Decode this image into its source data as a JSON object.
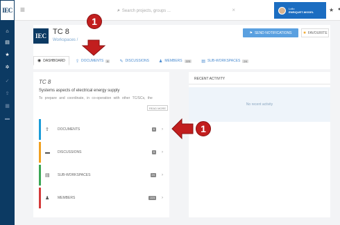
{
  "sidebar": {
    "logo_text": "IEC",
    "icons": [
      "home-icon",
      "list-icon",
      "star-icon",
      "gear-icon",
      "check-icon",
      "upload-icon",
      "calendar-icon",
      "chat-icon"
    ]
  },
  "topbar": {
    "menu_glyph": "≡",
    "search_icon": "⌕",
    "search_placeholder": "Search projects, groups ...",
    "clear_glyph": "×",
    "user": {
      "line1": "Lollo",
      "line2": "ENRIQUET-MODEL"
    },
    "star_glyph": "★",
    "bell_glyph": "●"
  },
  "header": {
    "logo_text": "IEC",
    "title": "TC 8",
    "breadcrumb": "Workspaces  /",
    "notify_label": "SEND NOTIFICATIONS",
    "notify_icon": "⚑",
    "favourite_label": "FAVOURITE",
    "favourite_icon": "★"
  },
  "tabs": [
    {
      "label": "DASHBOARD",
      "icon": "◉",
      "badge": ""
    },
    {
      "label": "DOCUMENTS",
      "icon": "⇪",
      "badge": "6"
    },
    {
      "label": "DISCUSSIONS",
      "icon": "✎",
      "badge": ""
    },
    {
      "label": "MEMBERS",
      "icon": "♟",
      "badge": "223"
    },
    {
      "label": "SUB-WORKSPACES",
      "icon": "▤",
      "badge": "24"
    }
  ],
  "overview": {
    "title": "TC 8",
    "subtitle": "Systems aspects of electrical energy supply",
    "description": "To prepare and coordinate, in co-operation with other TC/SCs, the",
    "read_more": "READ MORE"
  },
  "rows": [
    {
      "label": "DOCUMENTS",
      "icon": "⇪",
      "count": "6",
      "color": "#1b9cd8"
    },
    {
      "label": "DISCUSSIONS",
      "icon": "▬",
      "count": "0",
      "color": "#f0a020"
    },
    {
      "label": "SUB-WORKSPACES",
      "icon": "▤",
      "count": "24",
      "color": "#3aa655"
    },
    {
      "label": "MEMBERS",
      "icon": "♟",
      "count": "223",
      "color": "#d33a3a"
    }
  ],
  "activity": {
    "title": "RECENT ACTIVITY",
    "empty_text": "No recent activity"
  },
  "annotations": {
    "step_number": "1",
    "color": "#c21e1e"
  },
  "chevron": "›"
}
